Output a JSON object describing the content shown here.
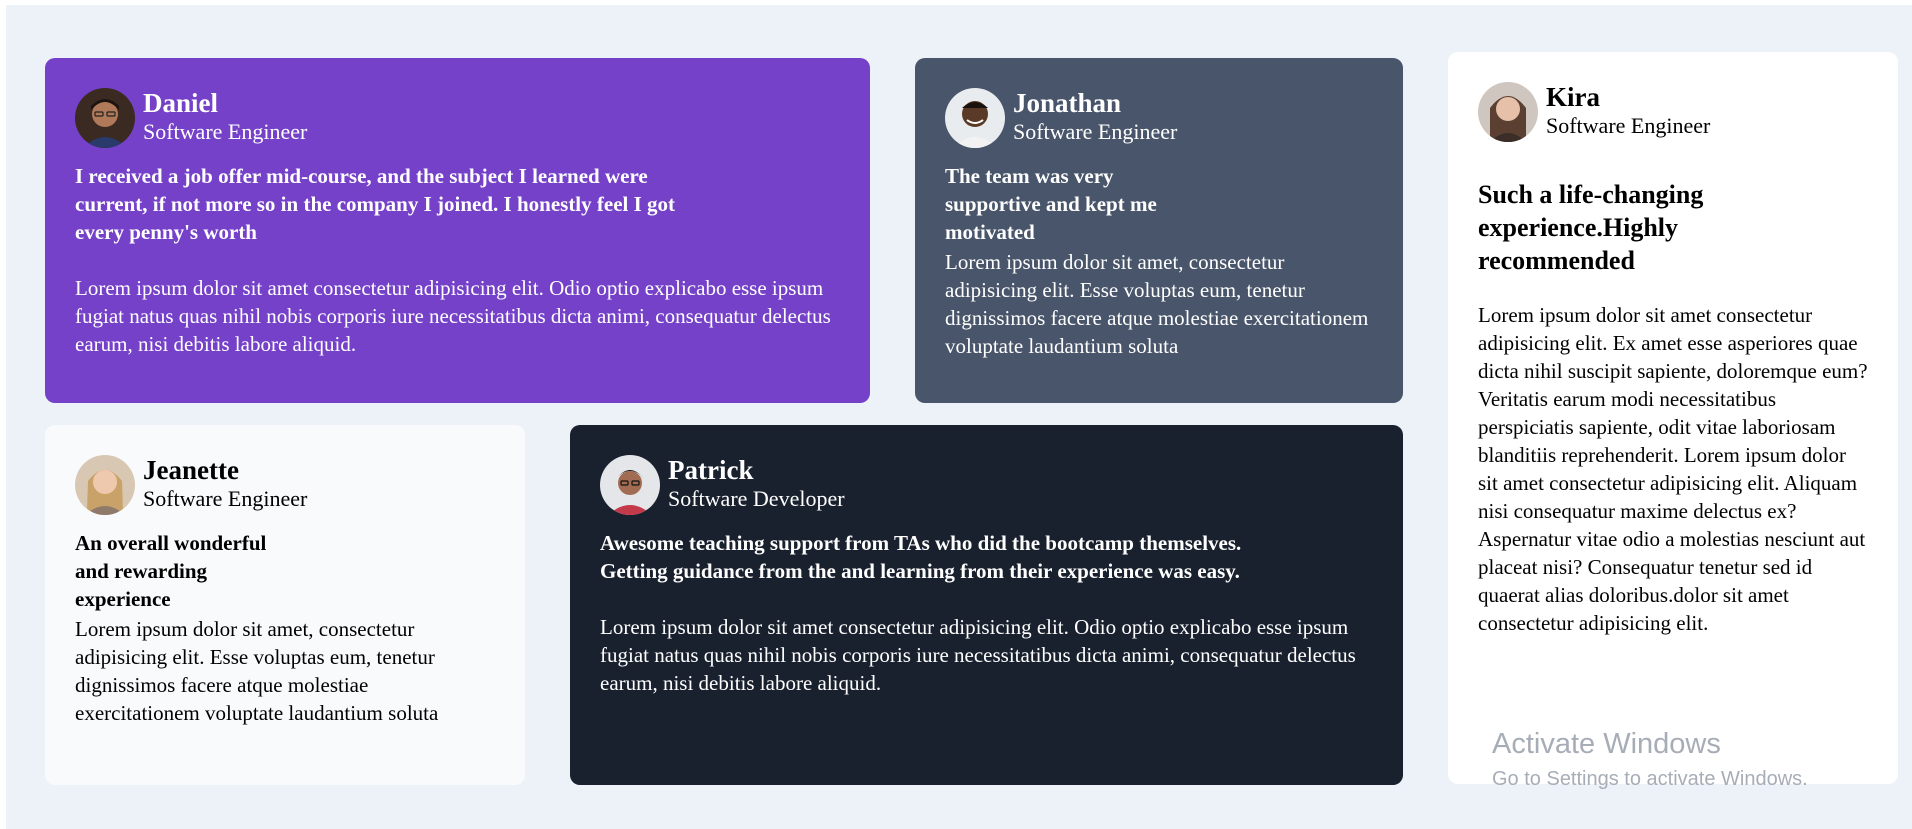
{
  "testimonials": [
    {
      "name": "Daniel",
      "role": "Software Engineer",
      "headline": "I received a job offer mid-course, and the subject I learned were current, if not more so in the company I joined. I honestly feel I got every penny's worth",
      "body": "Lorem ipsum dolor sit amet consectetur adipisicing elit. Odio optio explicabo esse ipsum fugiat natus quas nihil nobis corporis iure necessitatibus dicta animi, consequatur delectus earum, nisi debitis labore aliquid.",
      "background": "#7541c8"
    },
    {
      "name": "Jonathan",
      "role": "Software Engineer",
      "headline": "The team was very supportive and kept me motivated",
      "body": "Lorem ipsum dolor sit amet, consectetur adipisicing elit. Esse voluptas eum, tenetur dignissimos facere atque molestiae exercitationem voluptate laudantium soluta",
      "background": "#48556a"
    },
    {
      "name": "Kira",
      "role": "Software Engineer",
      "headline": "Such a life-changing experience.Highly recommended",
      "body": "Lorem ipsum dolor sit amet consectetur adipisicing elit. Ex amet esse asperiores quae dicta nihil suscipit sapiente, doloremque eum? Veritatis earum modi necessitatibus perspiciatis sapiente, odit vitae laboriosam blanditiis reprehenderit. Lorem ipsum dolor sit amet consectetur adipisicing elit. Aliquam nisi consequatur maxime delectus ex? Aspernatur vitae odio a molestias nesciunt aut placeat nisi? Consequatur tenetur sed id quaerat alias doloribus.dolor sit amet consectetur adipisicing elit.",
      "background": "#ffffff"
    },
    {
      "name": "Jeanette",
      "role": "Software Engineer",
      "headline": "An overall wonderful and rewarding experience",
      "body": "Lorem ipsum dolor sit amet, consectetur adipisicing elit. Esse voluptas eum, tenetur dignissimos facere atque molestiae exercitationem voluptate laudantium soluta",
      "background": "#f9fafb"
    },
    {
      "name": "Patrick",
      "role": "Software Developer",
      "headline": "Awesome teaching support from TAs who did the bootcamp themselves. Getting guidance from the and learning from their experience was easy.",
      "body": "Lorem ipsum dolor sit amet consectetur adipisicing elit. Odio optio explicabo esse ipsum fugiat natus quas nihil nobis corporis iure necessitatibus dicta animi, consequatur delectus earum, nisi debitis labore aliquid.",
      "background": "#19212e"
    }
  ],
  "watermark": {
    "title": "Activate Windows",
    "subtitle": "Go to Settings to activate Windows."
  },
  "page_background": "#edf2f8"
}
